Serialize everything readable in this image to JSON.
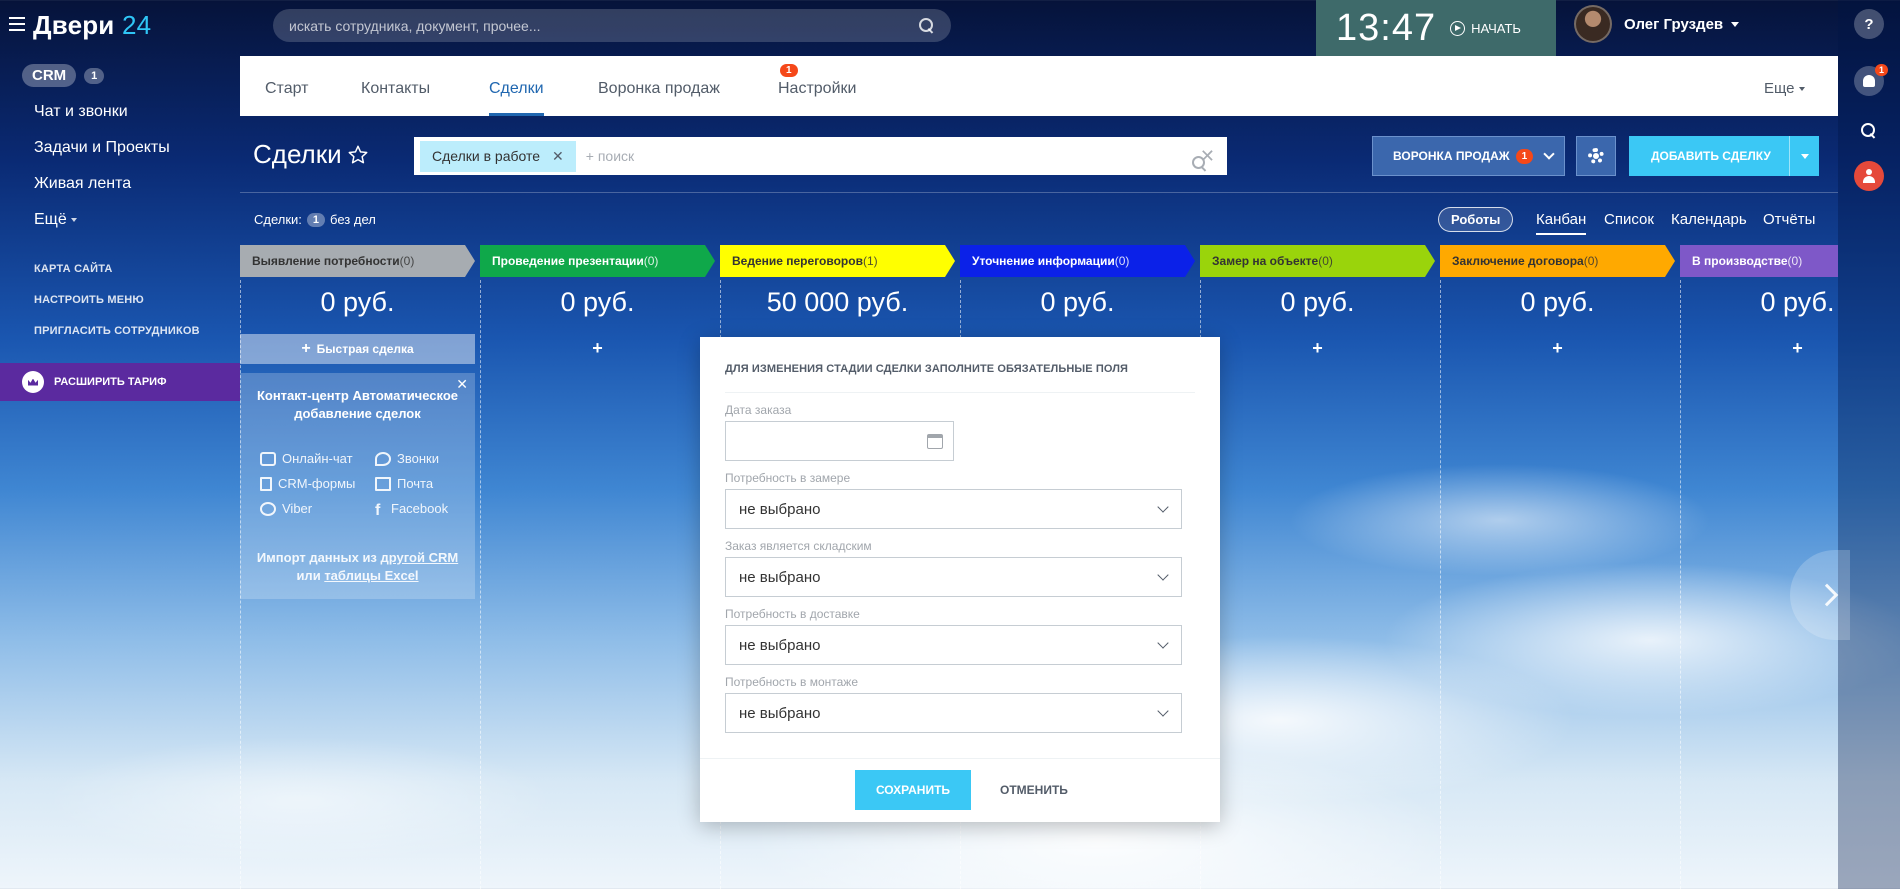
{
  "app": {
    "logo_text": "Двери",
    "logo_number": "24"
  },
  "header": {
    "search_placeholder": "искать сотрудника, документ, прочее...",
    "clock": "13:47",
    "start_label": "НАЧАТЬ",
    "user_name": "Олег Груздев"
  },
  "right_rail": {
    "help_label": "?",
    "notifications_count": "1"
  },
  "sidebar": {
    "crm_label": "CRM",
    "crm_count": "1",
    "items": [
      {
        "label": "Чат и звонки"
      },
      {
        "label": "Задачи и Проекты"
      },
      {
        "label": "Живая лента"
      },
      {
        "label": "Ещё"
      }
    ],
    "links": [
      {
        "label": "КАРТА САЙТА"
      },
      {
        "label": "НАСТРОИТЬ МЕНЮ"
      },
      {
        "label": "ПРИГЛАСИТЬ СОТРУДНИКОВ"
      }
    ],
    "extend_label": "РАСШИРИТЬ ТАРИФ"
  },
  "tabs": {
    "items": [
      {
        "label": "Старт"
      },
      {
        "label": "Контакты"
      },
      {
        "label": "Сделки",
        "active": true
      },
      {
        "label": "Воронка продаж"
      },
      {
        "label": "Настройки"
      }
    ],
    "deals_badge": "1",
    "more_label": "Еще"
  },
  "page": {
    "title": "Сделки",
    "filter_chip": "Сделки в работе",
    "filter_placeholder": "+ поиск",
    "funnel_button": "ВОРОНКА ПРОДАЖ",
    "funnel_badge": "1",
    "add_button": "ДОБАВИТЬ СДЕЛКУ",
    "deals_prefix": "Сделки:",
    "deals_count": "1",
    "deals_suffix": "без дел",
    "robots_label": "Роботы",
    "views": [
      {
        "label": "Канбан",
        "active": true
      },
      {
        "label": "Список"
      },
      {
        "label": "Календарь"
      },
      {
        "label": "Отчёты"
      }
    ]
  },
  "kanban": {
    "stages": [
      {
        "name": "Выявление потребности",
        "count": "(0)",
        "sum": "0 руб.",
        "color": "#a7acb1",
        "text_color": "#333333"
      },
      {
        "name": "Проведение презентации",
        "count": "(0)",
        "sum": "0 руб.",
        "color": "#0fa84a",
        "text_color": "#ffffff"
      },
      {
        "name": "Ведение переговоров",
        "count": "(1)",
        "sum": "50 000 руб.",
        "color": "#ffff00",
        "text_color": "#333333"
      },
      {
        "name": "Уточнение информации",
        "count": "(0)",
        "sum": "0 руб.",
        "color": "#0b21e8",
        "text_color": "#ffffff"
      },
      {
        "name": "Замер на объекте",
        "count": "(0)",
        "sum": "0 руб.",
        "color": "#9ad40b",
        "text_color": "#333333"
      },
      {
        "name": "Заключение договора",
        "count": "(0)",
        "sum": "0 руб.",
        "color": "#ffa900",
        "text_color": "#333333"
      },
      {
        "name": "В производстве",
        "count": "(0)",
        "sum": "0 руб.",
        "color": "#7e58c8",
        "text_color": "#ffffff"
      }
    ],
    "quick_deal_label": "Быстрая сделка",
    "contact_center": {
      "title": "Контакт-центр Автоматическое добавление сделок",
      "items": [
        {
          "label": "Онлайн-чат"
        },
        {
          "label": "Звонки"
        },
        {
          "label": "CRM-формы"
        },
        {
          "label": "Почта"
        },
        {
          "label": "Viber"
        },
        {
          "label": "Facebook"
        }
      ],
      "import_prefix": "Импорт данных из",
      "import_link1": "другой CRM",
      "import_or": "или",
      "import_link2": "таблицы Excel"
    }
  },
  "modal": {
    "title": "ДЛЯ ИЗМЕНЕНИЯ СТАДИИ СДЕЛКИ ЗАПОЛНИТЕ ОБЯЗАТЕЛЬНЫЕ ПОЛЯ",
    "date_label": "Дата заказа",
    "date_value": "",
    "fields": [
      {
        "label": "Потребность в замере",
        "value": "не выбрано"
      },
      {
        "label": "Заказ является складским",
        "value": "не выбрано"
      },
      {
        "label": "Потребность в доставке",
        "value": "не выбрано"
      },
      {
        "label": "Потребность в монтаже",
        "value": "не выбрано"
      }
    ],
    "save_label": "СОХРАНИТЬ",
    "cancel_label": "ОТМЕНИТЬ"
  }
}
